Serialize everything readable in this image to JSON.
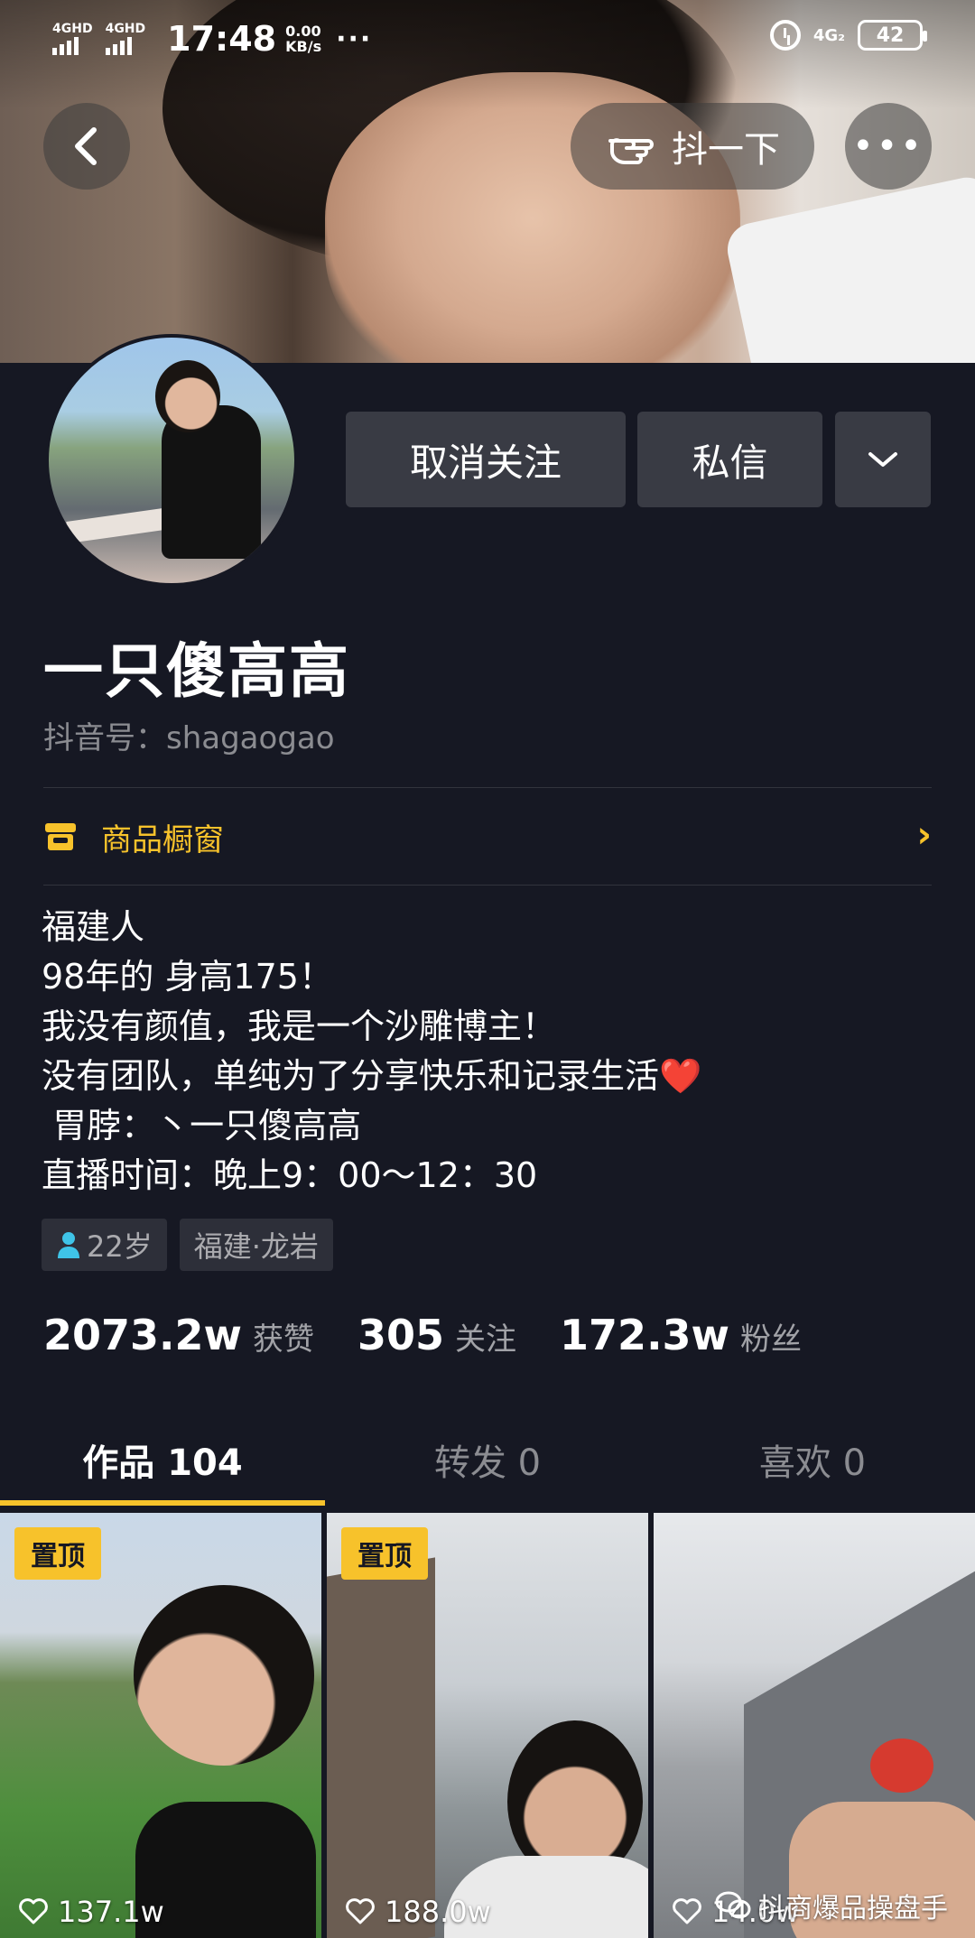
{
  "status_bar": {
    "network_1": "4GHD",
    "network_2": "4GHD",
    "time": "17:48",
    "speed_value": "0.00",
    "speed_unit": "KB/s",
    "more": "···",
    "network_right": "4G₂",
    "battery": "42"
  },
  "header": {
    "poke_label": "抖一下",
    "more_label": "•••"
  },
  "profile": {
    "unfollow_label": "取消关注",
    "message_label": "私信",
    "nickname": "一只傻高高",
    "account_id": "抖音号：shagaogao",
    "shop_label": "商品橱窗",
    "bio_lines": [
      "福建人",
      "98年的 身高175！",
      "我没有颜值，我是一个沙雕博主！",
      "没有团队，单纯为了分享快乐和记录生活❤️",
      " 胃脖：丶一只傻高高",
      "直播时间：晚上9：00～12：30"
    ],
    "tags": {
      "age": "22岁",
      "location": "福建·龙岩"
    }
  },
  "stats": {
    "likes_value": "2073.2w",
    "likes_label": "获赞",
    "following_value": "305",
    "following_label": "关注",
    "followers_value": "172.3w",
    "followers_label": "粉丝"
  },
  "tabs": [
    {
      "label": "作品 104"
    },
    {
      "label": "转发 0"
    },
    {
      "label": "喜欢 0"
    }
  ],
  "videos": [
    {
      "pinned": "置顶",
      "likes": "137.1w"
    },
    {
      "pinned": "置顶",
      "likes": "188.0w"
    },
    {
      "likes": "14.0w"
    }
  ],
  "watermark": "抖商爆品操盘手",
  "colors": {
    "background": "#161823",
    "accent": "#f7c22b",
    "button": "#393b44"
  }
}
